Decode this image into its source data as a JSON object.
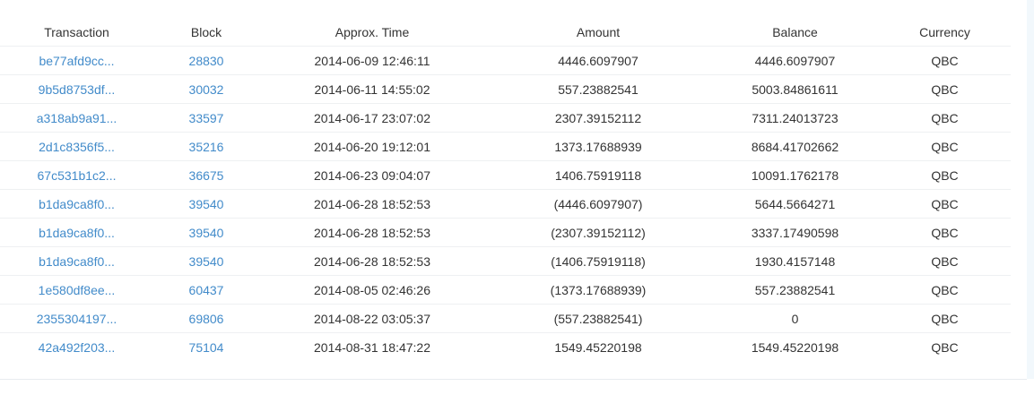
{
  "table": {
    "headers": {
      "transaction": "Transaction",
      "block": "Block",
      "time": "Approx. Time",
      "amount": "Amount",
      "balance": "Balance",
      "currency": "Currency"
    },
    "rows": [
      {
        "tx": "be77afd9cc...",
        "block": "28830",
        "time": "2014-06-09 12:46:11",
        "amount": "4446.6097907",
        "balance": "4446.6097907",
        "currency": "QBC"
      },
      {
        "tx": "9b5d8753df...",
        "block": "30032",
        "time": "2014-06-11 14:55:02",
        "amount": "557.23882541",
        "balance": "5003.84861611",
        "currency": "QBC"
      },
      {
        "tx": "a318ab9a91...",
        "block": "33597",
        "time": "2014-06-17 23:07:02",
        "amount": "2307.39152112",
        "balance": "7311.24013723",
        "currency": "QBC"
      },
      {
        "tx": "2d1c8356f5...",
        "block": "35216",
        "time": "2014-06-20 19:12:01",
        "amount": "1373.17688939",
        "balance": "8684.41702662",
        "currency": "QBC"
      },
      {
        "tx": "67c531b1c2...",
        "block": "36675",
        "time": "2014-06-23 09:04:07",
        "amount": "1406.75919118",
        "balance": "10091.1762178",
        "currency": "QBC"
      },
      {
        "tx": "b1da9ca8f0...",
        "block": "39540",
        "time": "2014-06-28 18:52:53",
        "amount": "(4446.6097907)",
        "balance": "5644.5664271",
        "currency": "QBC"
      },
      {
        "tx": "b1da9ca8f0...",
        "block": "39540",
        "time": "2014-06-28 18:52:53",
        "amount": "(2307.39152112)",
        "balance": "3337.17490598",
        "currency": "QBC"
      },
      {
        "tx": "b1da9ca8f0...",
        "block": "39540",
        "time": "2014-06-28 18:52:53",
        "amount": "(1406.75919118)",
        "balance": "1930.4157148",
        "currency": "QBC"
      },
      {
        "tx": "1e580df8ee...",
        "block": "60437",
        "time": "2014-08-05 02:46:26",
        "amount": "(1373.17688939)",
        "balance": "557.23882541",
        "currency": "QBC"
      },
      {
        "tx": "2355304197...",
        "block": "69806",
        "time": "2014-08-22 03:05:37",
        "amount": "(557.23882541)",
        "balance": "0",
        "currency": "QBC"
      },
      {
        "tx": "42a492f203...",
        "block": "75104",
        "time": "2014-08-31 18:47:22",
        "amount": "1549.45220198",
        "balance": "1549.45220198",
        "currency": "QBC"
      }
    ]
  },
  "colors": {
    "link": "#428bca",
    "text": "#333333",
    "row_border": "#eef0f2"
  }
}
